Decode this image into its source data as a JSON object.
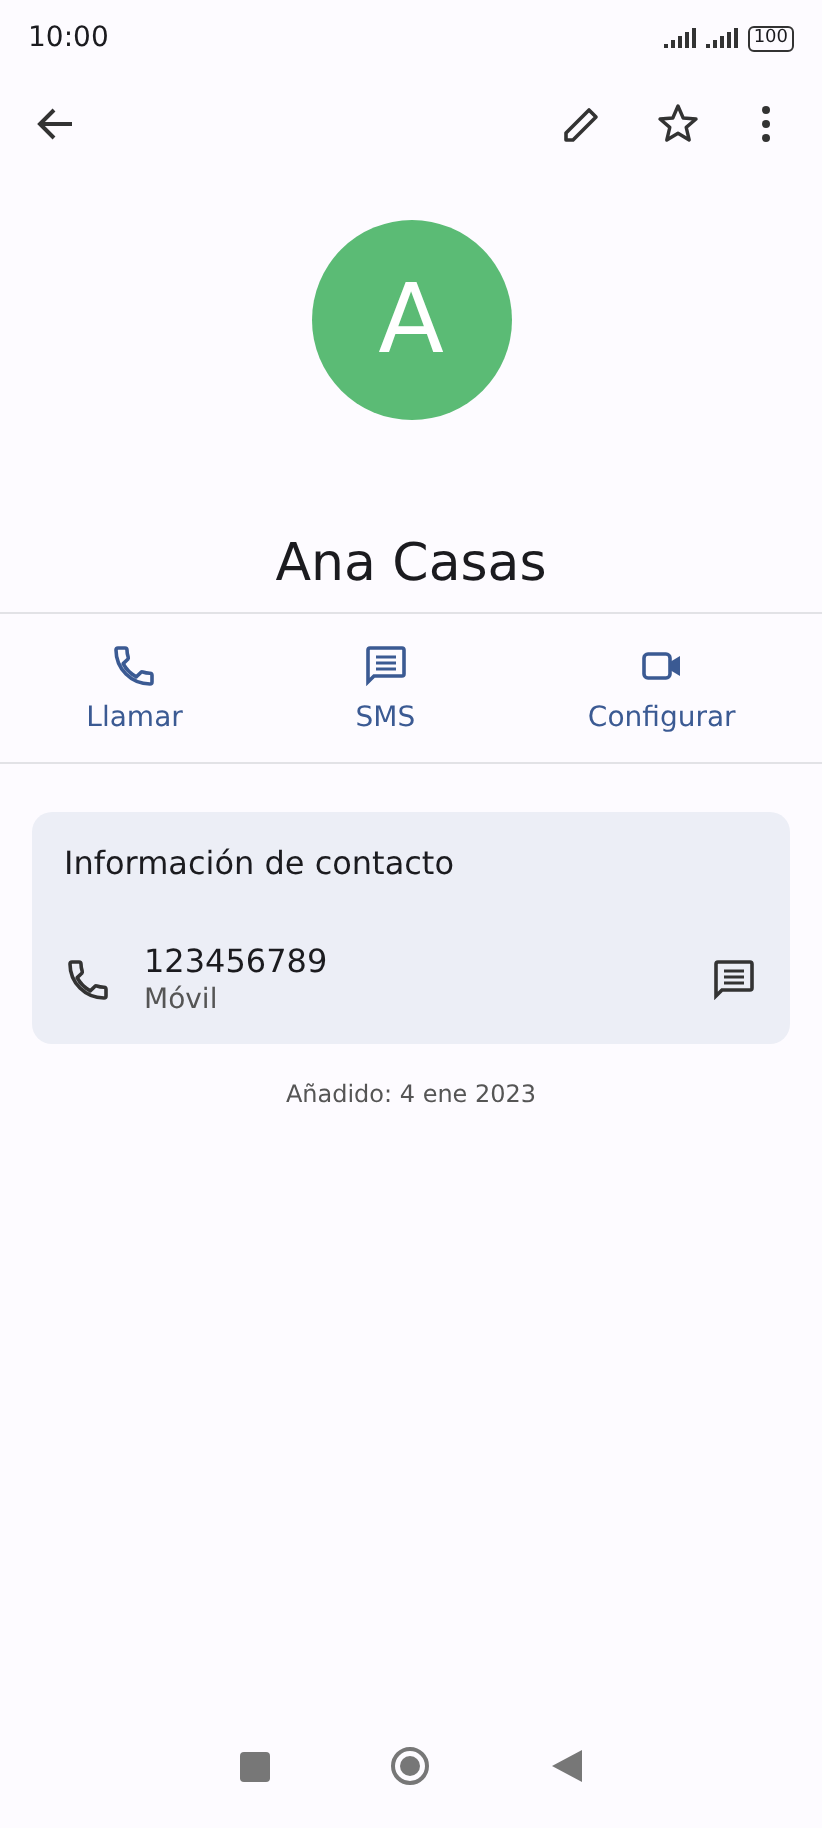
{
  "status_bar": {
    "time": "10:00",
    "battery": "100"
  },
  "contact": {
    "initial": "A",
    "name": "Ana Casas"
  },
  "actions": [
    {
      "kind": "call",
      "label": "Llamar"
    },
    {
      "kind": "sms",
      "label": "SMS"
    },
    {
      "kind": "video",
      "label": "Configurar"
    }
  ],
  "info_card": {
    "title": "Información de contacto",
    "phone": {
      "number": "123456789",
      "type": "Móvil"
    }
  },
  "added": "Añadido: 4 ene 2023"
}
